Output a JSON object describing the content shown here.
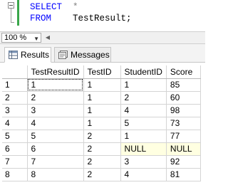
{
  "query": {
    "line1_keyword": "SELECT",
    "line1_rest": "*",
    "line2_keyword": "FROM",
    "line2_rest": "TestResult;"
  },
  "zoom": {
    "value": "100 %"
  },
  "tabs": [
    {
      "label": "Results",
      "icon": "grid-icon",
      "active": true
    },
    {
      "label": "Messages",
      "icon": "messages-icon",
      "active": false
    }
  ],
  "grid": {
    "columns": [
      "TestResultID",
      "TestID",
      "StudentID",
      "Score"
    ],
    "rows": [
      {
        "n": "1",
        "cells": [
          "1",
          "1",
          "1",
          "85"
        ]
      },
      {
        "n": "2",
        "cells": [
          "2",
          "1",
          "2",
          "60"
        ]
      },
      {
        "n": "3",
        "cells": [
          "3",
          "1",
          "4",
          "98"
        ]
      },
      {
        "n": "4",
        "cells": [
          "4",
          "1",
          "5",
          "73"
        ]
      },
      {
        "n": "5",
        "cells": [
          "5",
          "2",
          "1",
          "77"
        ]
      },
      {
        "n": "6",
        "cells": [
          "6",
          "2",
          "NULL",
          "NULL"
        ]
      },
      {
        "n": "7",
        "cells": [
          "7",
          "2",
          "3",
          "92"
        ]
      },
      {
        "n": "8",
        "cells": [
          "8",
          "2",
          "4",
          "81"
        ]
      }
    ]
  },
  "colors": {
    "keyword": "#0000ff",
    "null_cell_bg": "#ffffe1",
    "change_bar": "#3aa64a"
  }
}
